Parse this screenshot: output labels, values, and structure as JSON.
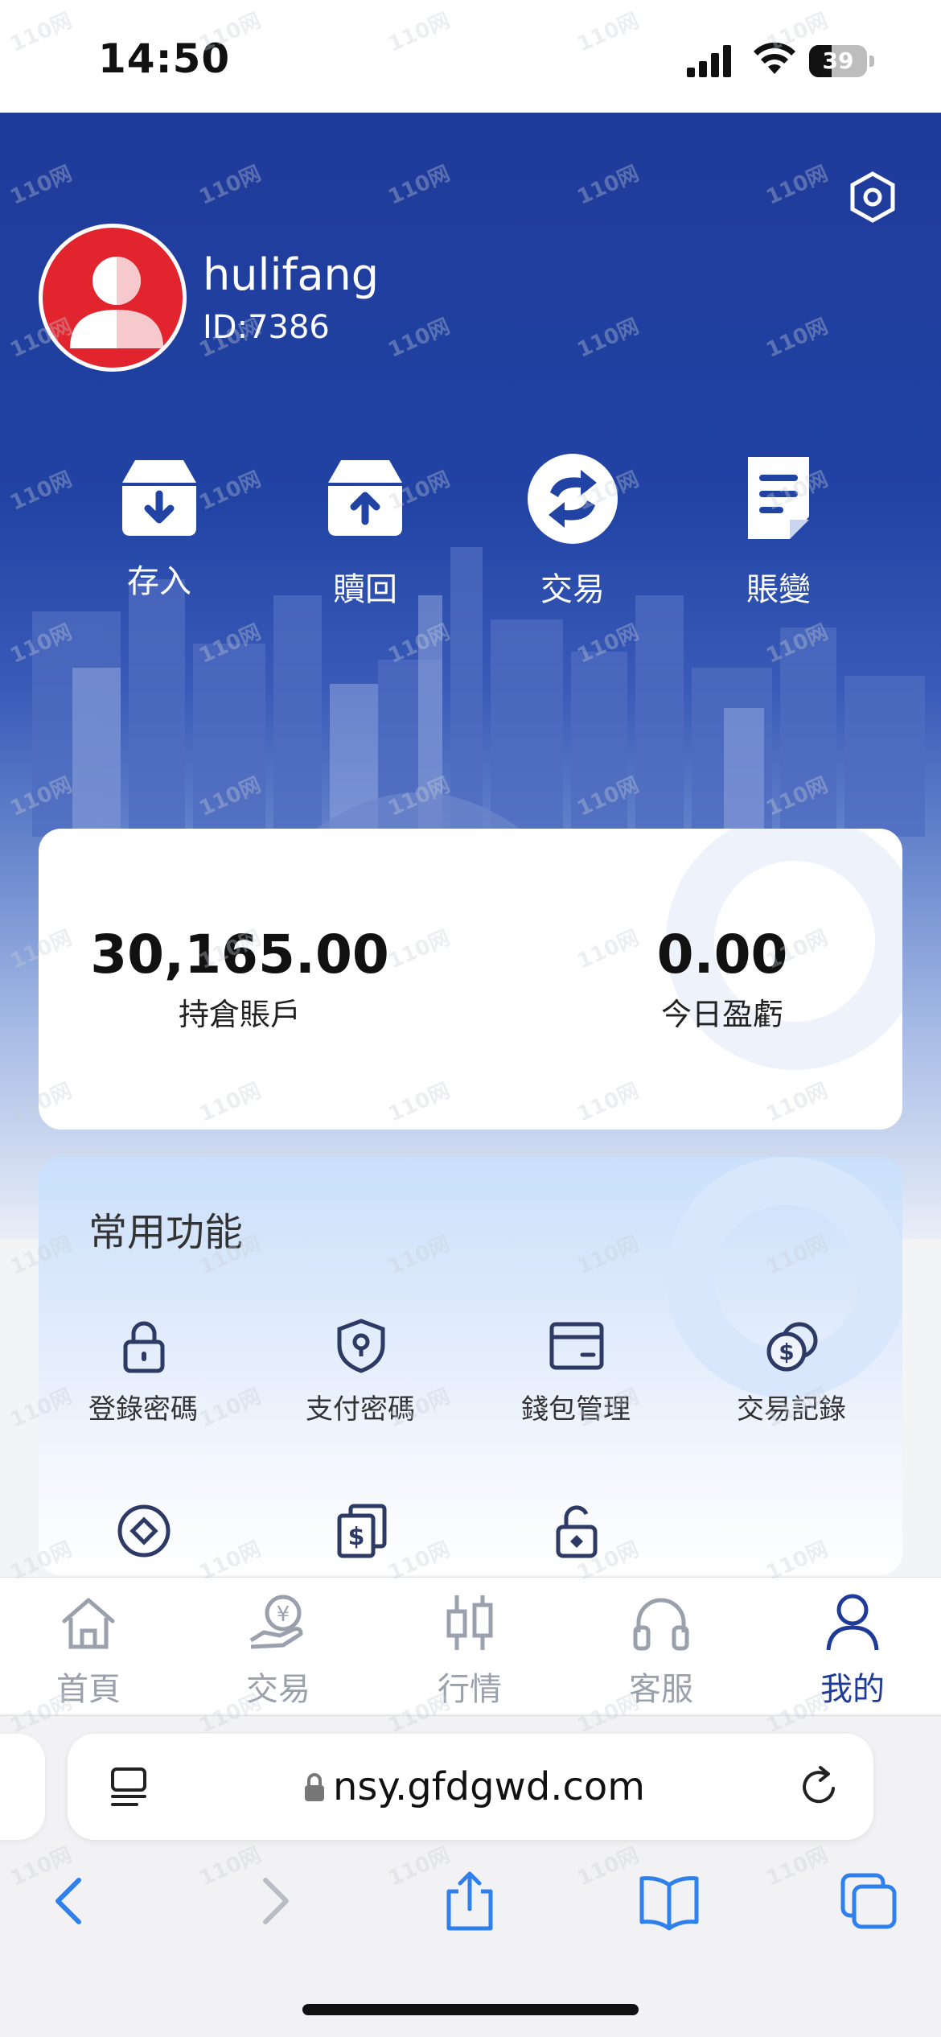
{
  "status_bar": {
    "time": "14:50",
    "battery": "39",
    "battery_level": 0.39
  },
  "profile": {
    "username": "hulifang",
    "user_id": "ID:7386"
  },
  "quick_actions": [
    {
      "label": "存入",
      "icon": "deposit-tray-icon"
    },
    {
      "label": "贖回",
      "icon": "withdraw-tray-icon"
    },
    {
      "label": "交易",
      "icon": "exchange-arrows-icon"
    },
    {
      "label": "賬變",
      "icon": "document-icon"
    }
  ],
  "balance": {
    "position_value": "30,165.00",
    "position_label": "持倉賬戶",
    "today_pnl_value": "0.00",
    "today_pnl_label": "今日盈虧"
  },
  "functions": {
    "title": "常用功能",
    "items": [
      {
        "label": "登錄密碼",
        "icon": "lock-icon"
      },
      {
        "label": "支付密碼",
        "icon": "shield-icon"
      },
      {
        "label": "錢包管理",
        "icon": "wallet-card-icon"
      },
      {
        "label": "交易記錄",
        "icon": "coins-icon"
      },
      {
        "label": "",
        "icon": "diamond-circle-icon"
      },
      {
        "label": "",
        "icon": "bill-stack-icon"
      },
      {
        "label": "",
        "icon": "unlock-icon"
      }
    ]
  },
  "tabbar": {
    "items": [
      {
        "label": "首頁",
        "icon": "home-icon",
        "active": false
      },
      {
        "label": "交易",
        "icon": "hand-coin-icon",
        "active": false
      },
      {
        "label": "行情",
        "icon": "candlestick-icon",
        "active": false
      },
      {
        "label": "客服",
        "icon": "headset-icon",
        "active": false
      },
      {
        "label": "我的",
        "icon": "person-icon",
        "active": true
      }
    ]
  },
  "browser": {
    "url": "nsy.gfdgwd.com"
  },
  "watermark": "110网",
  "colors": {
    "primary": "#1f3b9a",
    "avatar_red": "#e2242f",
    "inactive_tab": "#9aa0ac",
    "safari_blue": "#2f80ed"
  }
}
